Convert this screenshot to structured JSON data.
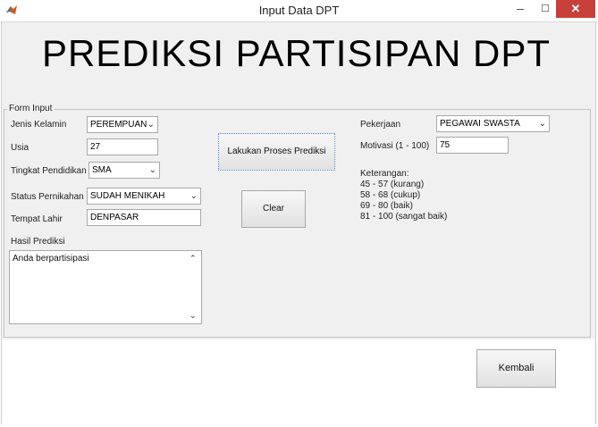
{
  "window": {
    "title": "Input Data DPT",
    "minimize_glyph": "–",
    "maximize_glyph": "☐",
    "close_glyph": "✕",
    "icon": "matlab-icon",
    "close_color": "#c7403a"
  },
  "header": {
    "title": "PREDIKSI PARTISIPAN DPT"
  },
  "form": {
    "legend": "Form Input",
    "jenis_kelamin": {
      "label": "Jenis Kelamin",
      "value": "PEREMPUAN"
    },
    "usia": {
      "label": "Usia",
      "value": "27"
    },
    "tingkat_pendidikan": {
      "label": "Tingkat Pendidikan",
      "value": "SMA"
    },
    "status_pernikahan": {
      "label": "Status Pernikahan",
      "value": "SUDAH MENIKAH"
    },
    "tempat_lahir": {
      "label": "Tempat Lahir",
      "value": "DENPASAR"
    },
    "hasil_prediksi": {
      "label": "Hasil Prediksi",
      "value": "Anda berpartisipasi"
    },
    "pekerjaan": {
      "label": "Pekerjaan",
      "value": "PEGAWAI SWASTA"
    },
    "motivasi": {
      "label": "Motivasi (1 - 100)",
      "value": "75"
    },
    "keterangan": {
      "label": "Keterangan:",
      "lines": [
        "45 - 57 (kurang)",
        "58 - 68 (cukup)",
        "69 - 80 (baik)",
        "81 - 100 (sangat baik)"
      ]
    }
  },
  "buttons": {
    "proses": "Lakukan Proses Prediksi",
    "clear": "Clear",
    "kembali": "Kembali"
  }
}
